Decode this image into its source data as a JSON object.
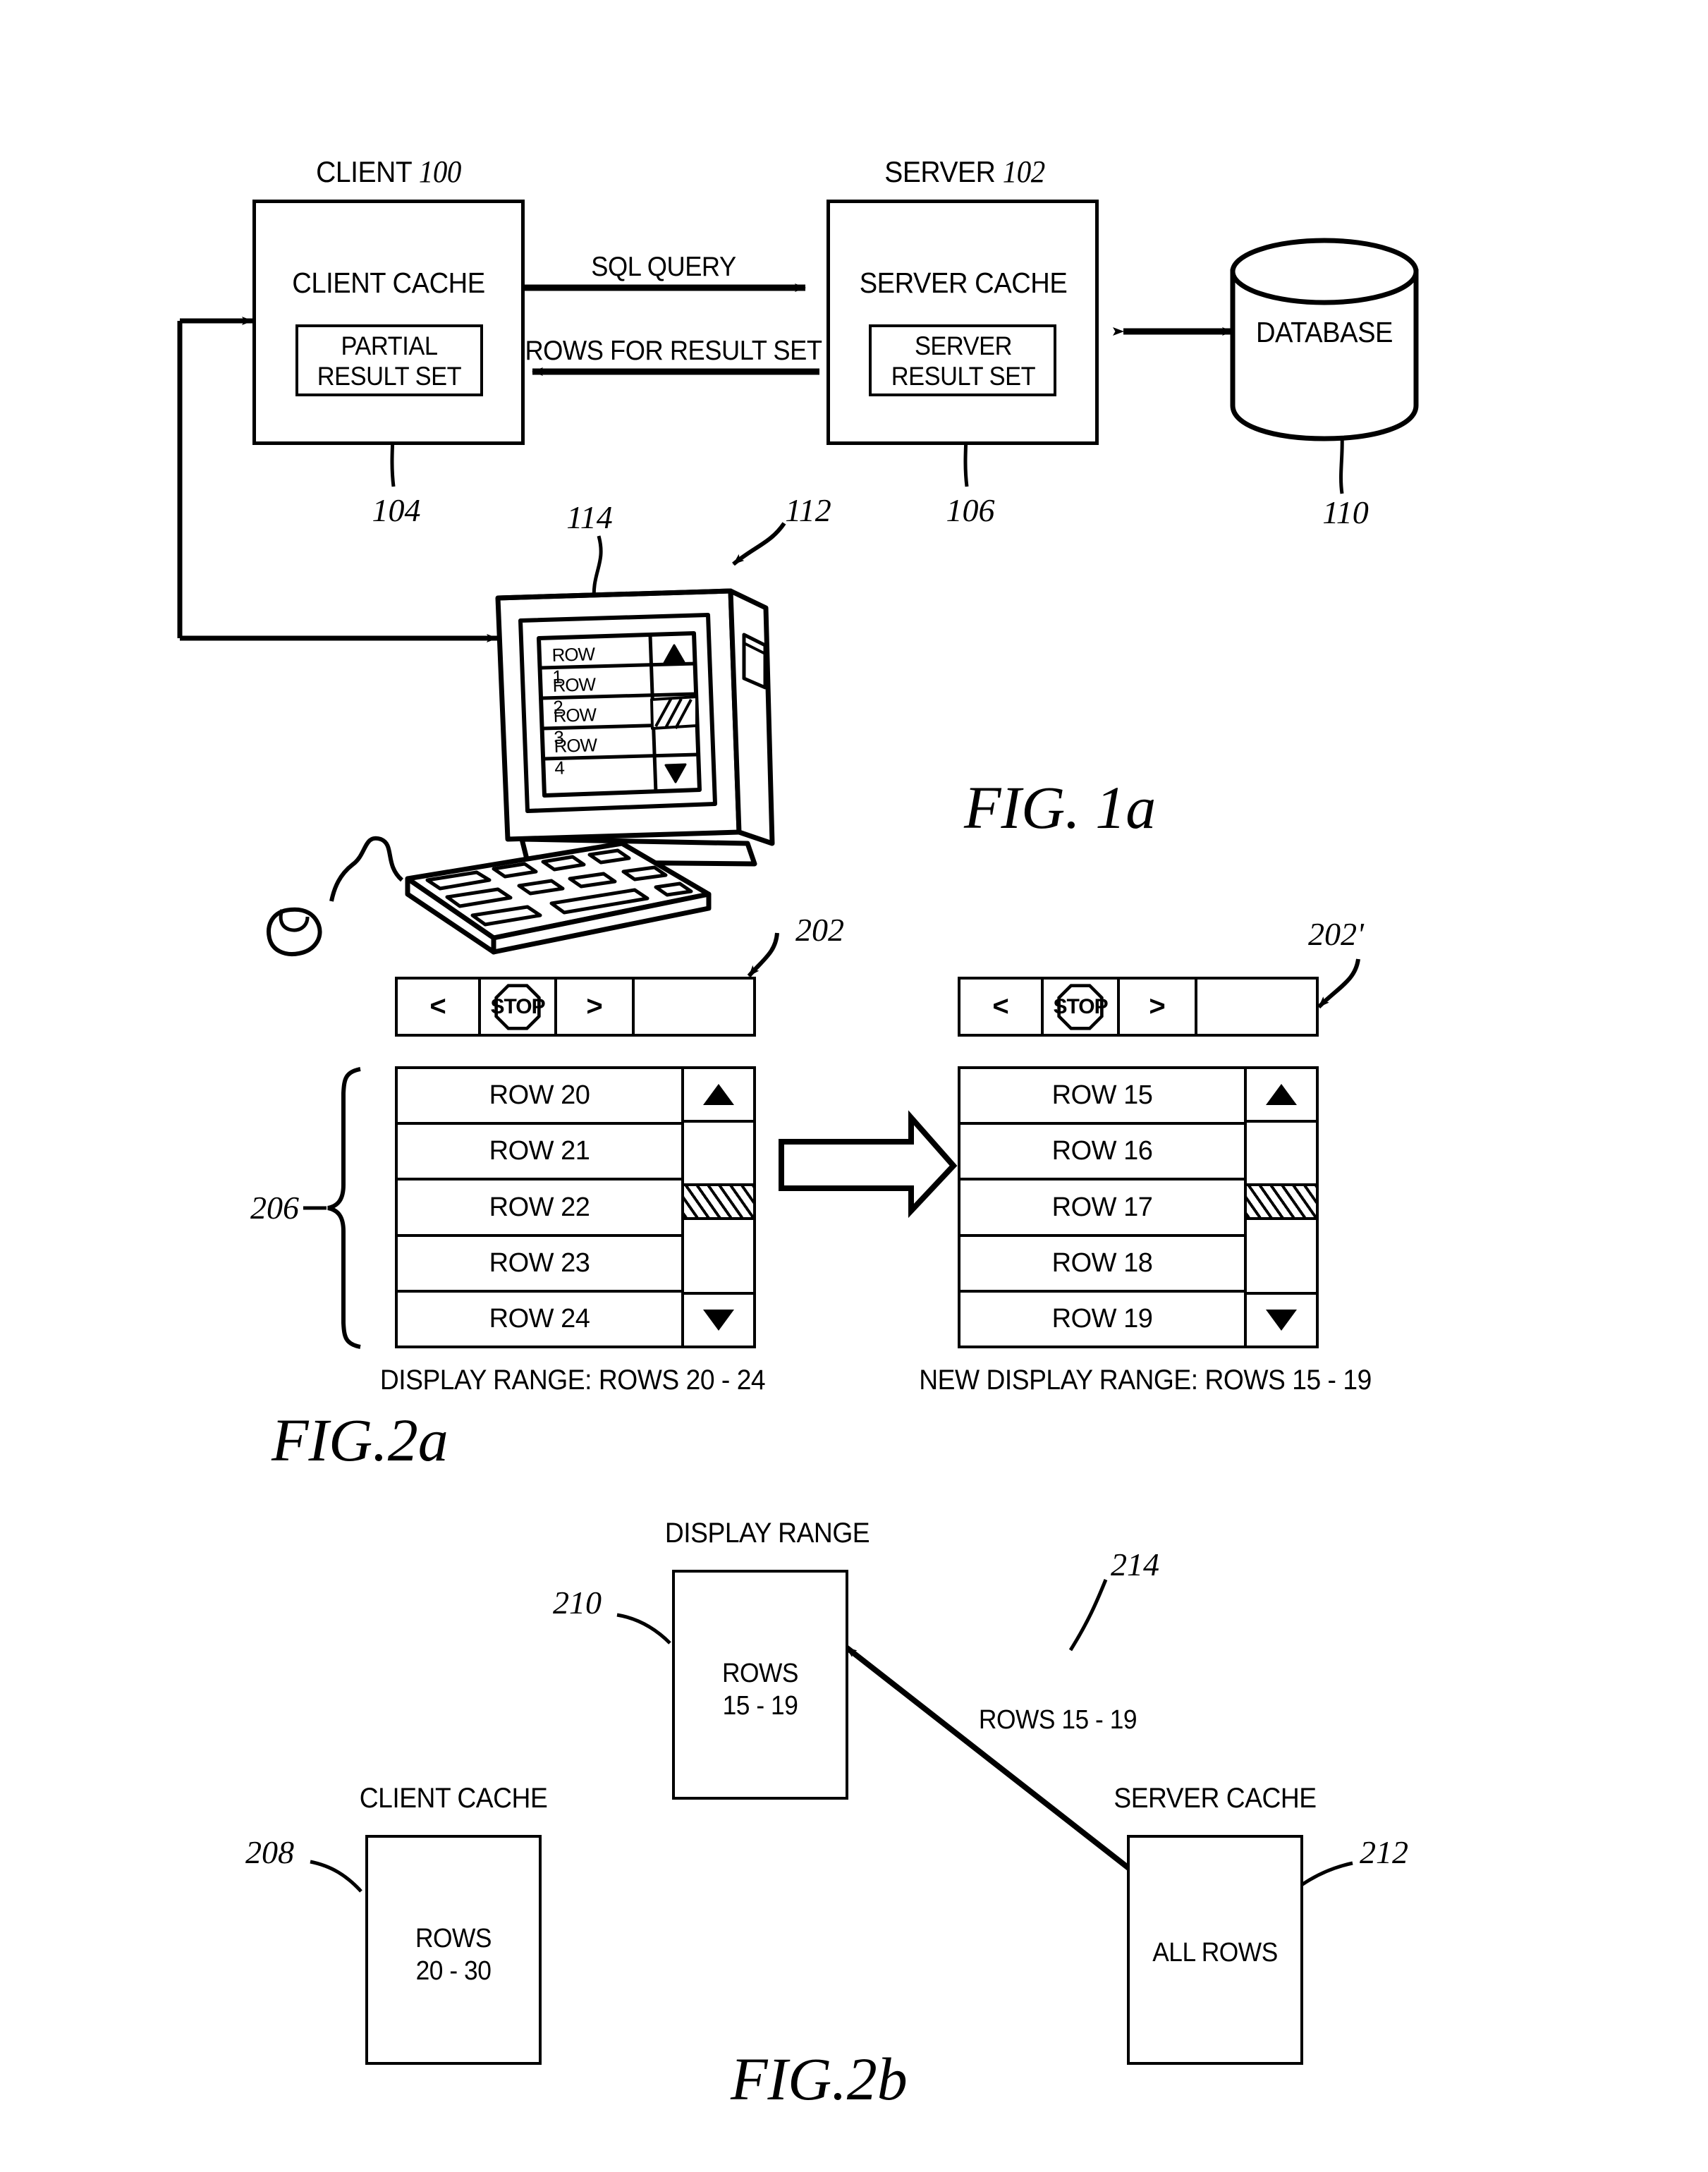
{
  "figures": [
    {
      "id": "fig1a",
      "label": "FIG. 1a"
    },
    {
      "id": "fig2a",
      "label": "FIG.2a"
    },
    {
      "id": "fig2b",
      "label": "FIG.2b"
    }
  ],
  "fig1a": {
    "client": {
      "title": "CLIENT 100",
      "title_text": "CLIENT",
      "title_ref": "100",
      "cache_label": "CLIENT CACHE",
      "inner_line1": "PARTIAL",
      "inner_line2": "RESULT SET",
      "inner_ref": "104"
    },
    "server": {
      "title": "SERVER 102",
      "title_text": "SERVER",
      "title_ref": "102",
      "cache_label": "SERVER CACHE",
      "inner_line1": "SERVER",
      "inner_line2": "RESULT SET",
      "inner_ref": "106"
    },
    "database": {
      "label": "DATABASE",
      "ref": "110"
    },
    "arrows": {
      "query_label": "SQL QUERY",
      "rows_label": "ROWS FOR RESULT SET"
    },
    "workstation": {
      "ref": "112",
      "screen_ref": "114",
      "rows": [
        "ROW 1",
        "ROW 2",
        "ROW 3",
        "ROW 4"
      ]
    }
  },
  "fig2a": {
    "toolbar": {
      "prev_label": "<",
      "stop_label": "STOP",
      "next_label": ">",
      "blank_label": ""
    },
    "left_panel": {
      "ref": "202",
      "brace_ref": "206",
      "rows": [
        "ROW 20",
        "ROW 21",
        "ROW 22",
        "ROW 23",
        "ROW 24"
      ],
      "caption": "DISPLAY RANGE:  ROWS 20 - 24",
      "scroll_up_icon": "triangle-up",
      "scroll_down_icon": "triangle-down"
    },
    "right_panel": {
      "ref": "202'",
      "rows": [
        "ROW 15",
        "ROW 16",
        "ROW 17",
        "ROW 18",
        "ROW 19"
      ],
      "caption": "NEW DISPLAY RANGE: ROWS 15 - 19",
      "scroll_up_icon": "triangle-up",
      "scroll_down_icon": "triangle-down"
    }
  },
  "fig2b": {
    "display_range": {
      "title": "DISPLAY RANGE",
      "ref": "210",
      "line1": "ROWS",
      "line2": "15 - 19"
    },
    "client_cache": {
      "title": "CLIENT CACHE",
      "ref": "208",
      "line1": "ROWS",
      "line2": "20 - 30"
    },
    "server_cache": {
      "title": "SERVER CACHE",
      "ref": "212",
      "line1": "ALL ROWS"
    },
    "transfer": {
      "ref": "214",
      "label": "ROWS 15 - 19"
    }
  }
}
